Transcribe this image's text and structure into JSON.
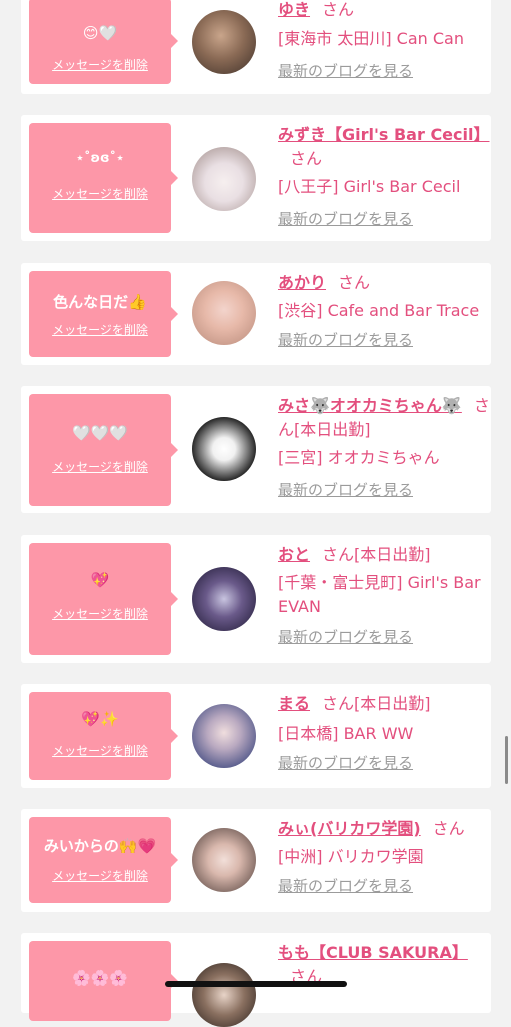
{
  "cards": [
    {
      "message": "😊🤍",
      "delete_label": "メッセージを削除",
      "name": "ゆき",
      "san": "さん",
      "shop": "[東海市 太田川] Can Can",
      "blog_label": "最新のブログを見る"
    },
    {
      "message": "⋆˚ʚɞ˚⋆",
      "delete_label": "メッセージを削除",
      "name": "みずき【Girl's Bar Cecil】",
      "san": "さん",
      "shop": "[八王子] Girl's Bar Cecil",
      "blog_label": "最新のブログを見る"
    },
    {
      "message": "色んな日だ👍",
      "delete_label": "メッセージを削除",
      "name": "あかり",
      "san": "さん",
      "shop": "[渋谷] Cafe and Bar Trace",
      "blog_label": "最新のブログを見る"
    },
    {
      "message": "🤍🤍🤍",
      "delete_label": "メッセージを削除",
      "name": "みさ🐺オオカミちゃん🐺",
      "san": "さん[本日出勤]",
      "shop": "[三宮] オオカミちゃん",
      "blog_label": "最新のブログを見る"
    },
    {
      "message": "💖",
      "delete_label": "メッセージを削除",
      "name": "おと",
      "san": "さん[本日出勤]",
      "shop": "[千葉・富士見町] Girl's Bar EVAN",
      "blog_label": "最新のブログを見る"
    },
    {
      "message": "💖✨",
      "delete_label": "メッセージを削除",
      "name": "まる",
      "san": "さん[本日出勤]",
      "shop": "[日本橋] BAR WW",
      "blog_label": "最新のブログを見る"
    },
    {
      "message": "みいからの🙌💗",
      "delete_label": "メッセージを削除",
      "name": "みぃ(バリカワ学園)",
      "san": "さん",
      "shop": "[中洲] バリカワ学園",
      "blog_label": "最新のブログを見る"
    },
    {
      "message": "🌸🌸🌸",
      "delete_label": "",
      "name": "もも【CLUB SAKURA】",
      "san": "さん",
      "shop": "",
      "blog_label": ""
    }
  ],
  "colors": {
    "accent_pink": "#e34f7e",
    "bubble_pink": "#fd97a8",
    "link_gray": "#9b9b9b"
  }
}
